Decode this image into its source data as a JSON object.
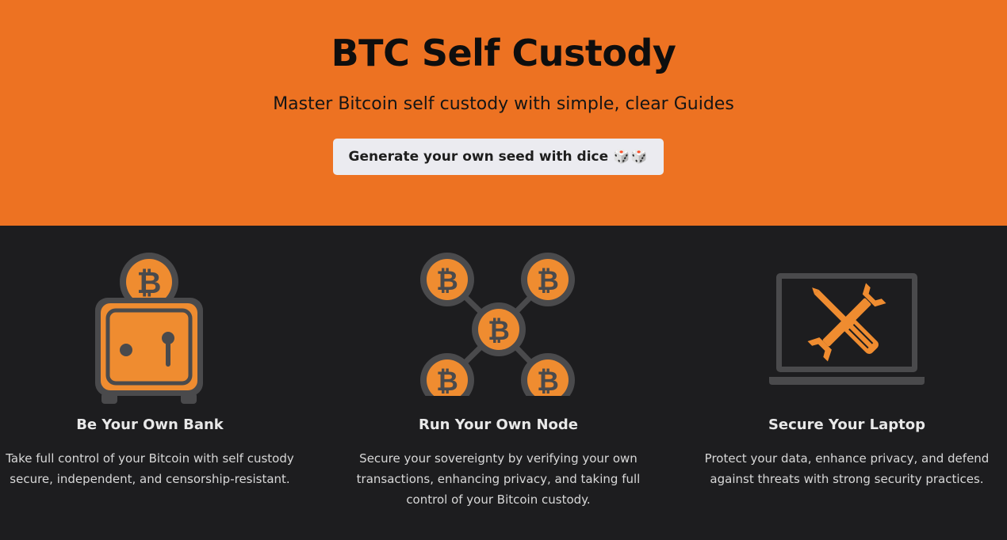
{
  "hero": {
    "title": "BTC Self Custody",
    "subtitle": "Master Bitcoin self custody with simple, clear Guides",
    "cta_label": "Generate your own seed with dice",
    "cta_emoji": "🎲🎲"
  },
  "features": [
    {
      "icon": "safe-with-bitcoin-icon",
      "title": "Be Your Own Bank",
      "description": "Take full control of your Bitcoin with self custody secure, independent, and censorship-resistant."
    },
    {
      "icon": "bitcoin-node-network-icon",
      "title": "Run Your Own Node",
      "description": "Secure your sovereignty by verifying your own transactions, enhancing privacy, and taking full control of your Bitcoin custody."
    },
    {
      "icon": "laptop-tools-icon",
      "title": "Secure Your Laptop",
      "description": "Protect your data, enhance privacy, and defend against threats with strong security practices."
    }
  ],
  "colors": {
    "brand_orange": "#ed7222",
    "icon_orange": "#ef8c30",
    "icon_gray": "#4a4a4c",
    "dark_background": "#1d1d1f"
  }
}
